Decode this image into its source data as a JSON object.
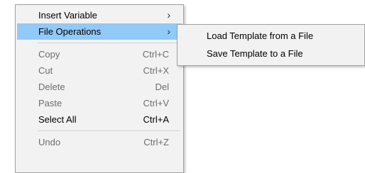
{
  "main_menu": {
    "insert_variable": {
      "label": "Insert Variable",
      "arrow": "›"
    },
    "file_operations": {
      "label": "File Operations",
      "arrow": "›"
    },
    "copy": {
      "label": "Copy",
      "shortcut": "Ctrl+C"
    },
    "cut": {
      "label": "Cut",
      "shortcut": "Ctrl+X"
    },
    "delete": {
      "label": "Delete",
      "shortcut": "Del"
    },
    "paste": {
      "label": "Paste",
      "shortcut": "Ctrl+V"
    },
    "select_all": {
      "label": "Select All",
      "shortcut": "Ctrl+A"
    },
    "undo": {
      "label": "Undo",
      "shortcut": "Ctrl+Z"
    }
  },
  "sub_menu": {
    "load_template": {
      "label": "Load Template from a File"
    },
    "save_template": {
      "label": "Save Template to a File"
    }
  },
  "colors": {
    "highlight": "#91c9f7",
    "disabled_text": "#6d6d6d",
    "menu_background": "#f2f2f2"
  },
  "icons": {
    "submenu_arrow": "chevron-right-icon"
  }
}
